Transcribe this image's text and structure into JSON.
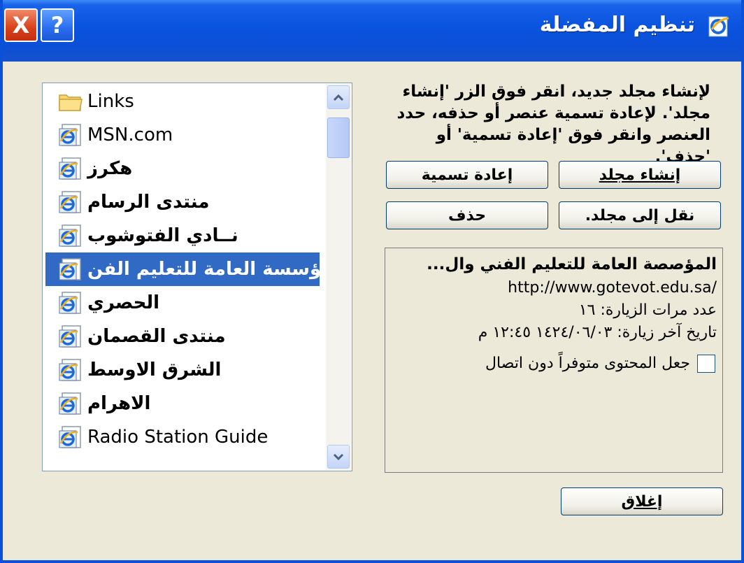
{
  "window": {
    "title": "تنظيم المفضلة",
    "close_label": "X",
    "help_label": "?"
  },
  "favorites_list": {
    "items": [
      {
        "label": "Links",
        "icon": "folder-icon",
        "rtl": false
      },
      {
        "label": "MSN.com",
        "icon": "ie-page-icon",
        "rtl": false
      },
      {
        "label": "هكرز",
        "icon": "ie-page-icon",
        "rtl": true
      },
      {
        "label": "منتدى الرسام",
        "icon": "ie-page-icon",
        "rtl": true
      },
      {
        "label": "نــادي الفتوشوب",
        "icon": "ie-page-icon",
        "rtl": true
      },
      {
        "label": "...المؤسسة العامة للتعليم الفن",
        "icon": "ie-page-icon",
        "rtl": true,
        "selected": true
      },
      {
        "label": "الحصري",
        "icon": "ie-page-icon",
        "rtl": true
      },
      {
        "label": "منتدى القصمان",
        "icon": "ie-page-icon",
        "rtl": true
      },
      {
        "label": "الشرق الاوسط",
        "icon": "ie-page-icon",
        "rtl": true
      },
      {
        "label": "الاهرام",
        "icon": "ie-page-icon",
        "rtl": true
      },
      {
        "label": "Radio Station Guide",
        "icon": "ie-page-icon",
        "rtl": false
      }
    ]
  },
  "instructions": "لإنشاء مجلد جديد، انقر فوق الزر 'إنشاء مجلد'. لإعادة تسمية عنصر أو حذفه، حدد العنصر وانقر فوق 'إعادة تسمية' أو 'حذف'.",
  "buttons": {
    "create_folder": "إنشاء مجلد",
    "rename": "إعادة تسمية",
    "move_to_folder": "نقل إلى مجلد.",
    "delete": "حذف",
    "close": "إغلاق"
  },
  "details": {
    "name": "المؤصصة العامة للتعليم الفني وال...",
    "url": "http://www.gotevot.edu.sa/",
    "visits": "عدد مرات الزيارة: ١٦",
    "last_visit": "تاريخ آخر زيارة: ١٤٢٤/٠٦/٠٣ ١٢:٤٥ م",
    "offline_label": "جعل المحتوى متوفراً دون اتصال",
    "offline_checked": false
  },
  "colors": {
    "titlebar": "#0b4fd6",
    "selection": "#316ac5",
    "dialog_bg": "#ece9d8"
  }
}
